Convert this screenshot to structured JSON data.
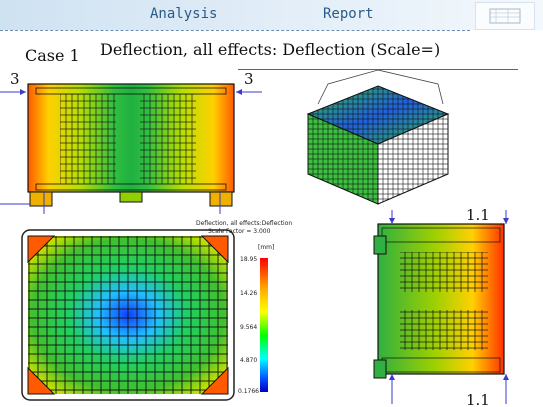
{
  "header": {
    "title": "Analysis",
    "subtitle": "Report"
  },
  "case_label": "Case 1",
  "main_title": "Deflection, all effects: Deflection (Scale=)",
  "markers": {
    "left_top": "3",
    "right_top": "3",
    "side_top": "1.1",
    "side_bottom": "1.1"
  },
  "legend": {
    "title": "Deflection, all effects:Deflection",
    "subtitle": "Scale Factor = 3.000",
    "unit": "[mm]",
    "ticks": [
      "18.95",
      "14.26",
      "9.564",
      "4.870",
      "0.1766"
    ]
  },
  "colors": {
    "header_text": "#2a5a8a",
    "accent_line": "#1a8a5a"
  }
}
